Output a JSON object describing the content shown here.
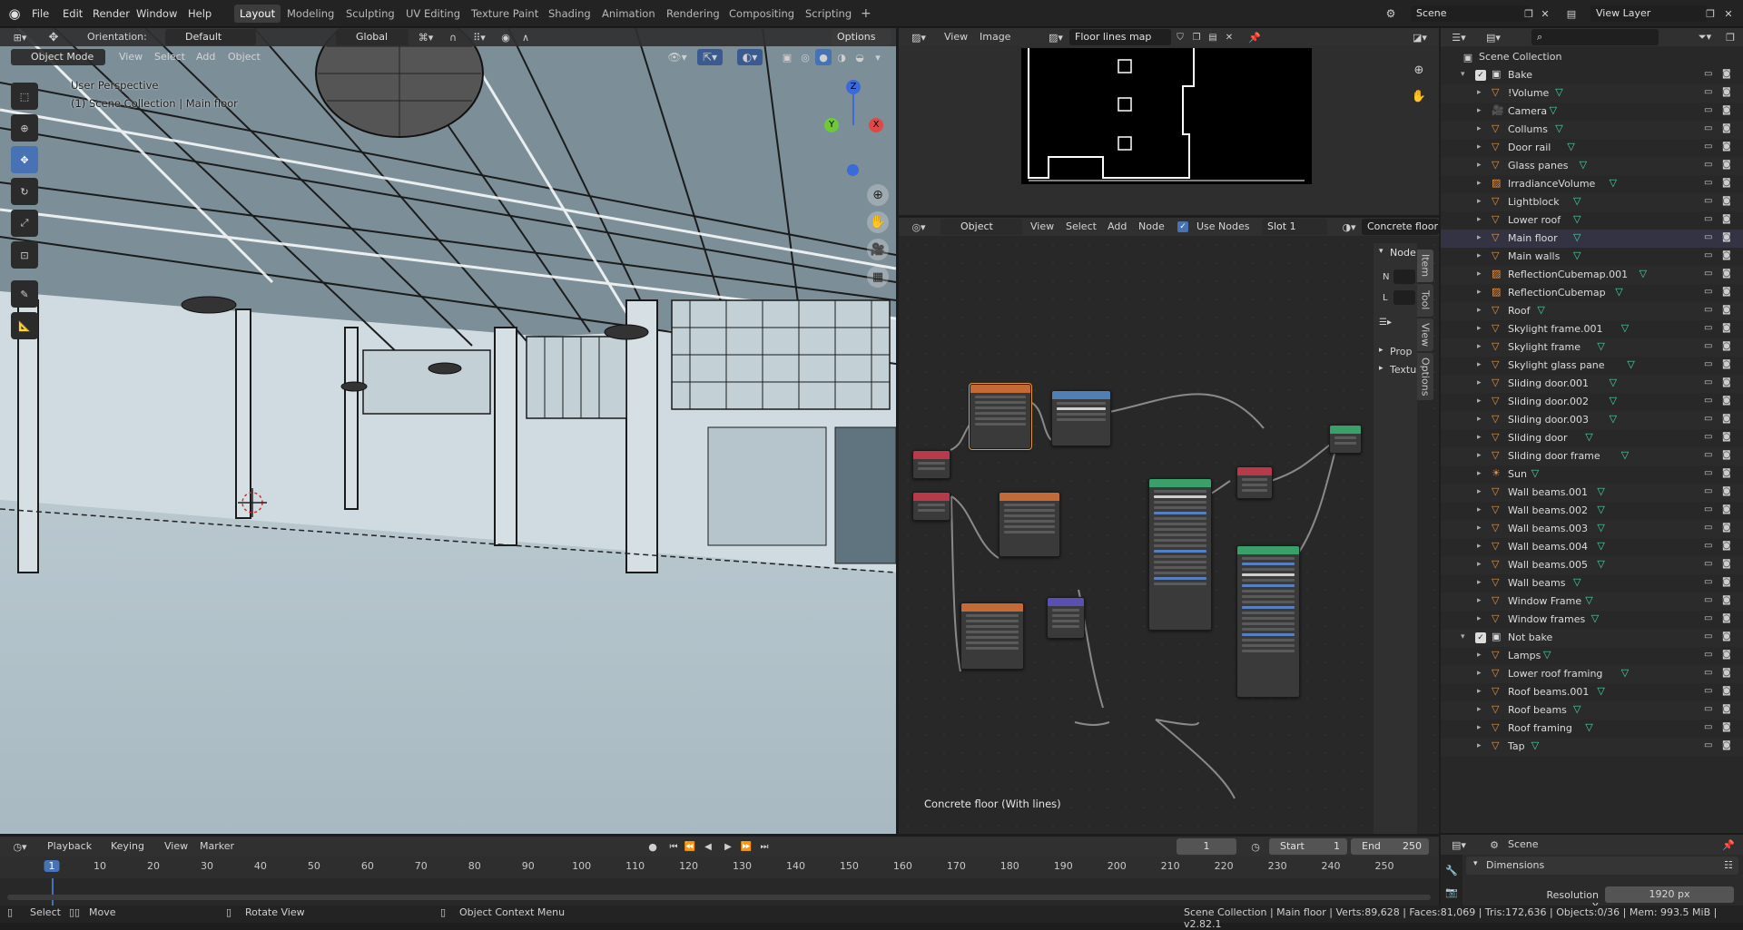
{
  "topbar": {
    "menus": [
      "File",
      "Edit",
      "Render",
      "Window",
      "Help"
    ],
    "workspaces": [
      "Layout",
      "Modeling",
      "Sculpting",
      "UV Editing",
      "Texture Paint",
      "Shading",
      "Animation",
      "Rendering",
      "Compositing",
      "Scripting"
    ],
    "add_workspace": "+",
    "scene": "Scene",
    "view_layer": "View Layer"
  },
  "viewport": {
    "orientation_label": "Orientation:",
    "orientation_value": "Default",
    "transform_space": "Global",
    "options": "Options",
    "mode": "Object Mode",
    "menus": [
      "View",
      "Select",
      "Add",
      "Object"
    ],
    "overlay_title": "User Perspective",
    "overlay_collection": "(1) Scene Collection | Main floor",
    "gizmo_axes": [
      "Z",
      "Y",
      "X"
    ]
  },
  "image_editor": {
    "menus": [
      "View",
      "Image"
    ],
    "image_name": "Floor lines map"
  },
  "node_editor": {
    "object": "Object",
    "menus": [
      "View",
      "Select",
      "Add",
      "Node"
    ],
    "use_nodes": "Use Nodes",
    "slot": "Slot 1",
    "material": "Concrete floor",
    "footer_label": "Concrete floor (With lines)",
    "sidebar_header": "Node",
    "sidebar_fields": [
      "N",
      "L"
    ],
    "sidebar_panels": [
      "Prop",
      "Textu"
    ],
    "sidebar_tabs": [
      "Item",
      "Tool",
      "View",
      "Options"
    ]
  },
  "outliner": {
    "root": "Scene Collection",
    "items": [
      {
        "label": "Bake",
        "kind": "collection"
      },
      {
        "label": "!Volume",
        "kind": "object"
      },
      {
        "label": "Camera",
        "kind": "camera"
      },
      {
        "label": "Collums",
        "kind": "object"
      },
      {
        "label": "Door rail",
        "kind": "object"
      },
      {
        "label": "Glass panes",
        "kind": "object"
      },
      {
        "label": "IrradianceVolume",
        "kind": "probe"
      },
      {
        "label": "Lightblock",
        "kind": "object"
      },
      {
        "label": "Lower roof",
        "kind": "object"
      },
      {
        "label": "Main floor",
        "kind": "object"
      },
      {
        "label": "Main walls",
        "kind": "object"
      },
      {
        "label": "ReflectionCubemap.001",
        "kind": "probe"
      },
      {
        "label": "ReflectionCubemap",
        "kind": "probe"
      },
      {
        "label": "Roof",
        "kind": "object"
      },
      {
        "label": "Skylight frame.001",
        "kind": "object"
      },
      {
        "label": "Skylight frame",
        "kind": "object"
      },
      {
        "label": "Skylight glass pane",
        "kind": "object"
      },
      {
        "label": "Sliding door.001",
        "kind": "object"
      },
      {
        "label": "Sliding door.002",
        "kind": "object"
      },
      {
        "label": "Sliding door.003",
        "kind": "object"
      },
      {
        "label": "Sliding door",
        "kind": "object"
      },
      {
        "label": "Sliding door frame",
        "kind": "object"
      },
      {
        "label": "Sun",
        "kind": "light"
      },
      {
        "label": "Wall beams.001",
        "kind": "object"
      },
      {
        "label": "Wall beams.002",
        "kind": "object"
      },
      {
        "label": "Wall beams.003",
        "kind": "object"
      },
      {
        "label": "Wall beams.004",
        "kind": "object"
      },
      {
        "label": "Wall beams.005",
        "kind": "object"
      },
      {
        "label": "Wall beams",
        "kind": "object"
      },
      {
        "label": "Window Frame",
        "kind": "object"
      },
      {
        "label": "Window frames",
        "kind": "object"
      },
      {
        "label": "Not bake",
        "kind": "collection"
      },
      {
        "label": "Lamps",
        "kind": "object"
      },
      {
        "label": "Lower roof framing",
        "kind": "object"
      },
      {
        "label": "Roof beams.001",
        "kind": "object"
      },
      {
        "label": "Roof beams",
        "kind": "object"
      },
      {
        "label": "Roof framing",
        "kind": "object"
      },
      {
        "label": "Tap",
        "kind": "object"
      }
    ]
  },
  "properties": {
    "context": "Scene",
    "panel": "Dimensions",
    "resolution_label": "Resolution X",
    "resolution_value": "1920 px"
  },
  "timeline": {
    "menus": [
      "Playback",
      "Keying",
      "View",
      "Marker"
    ],
    "current_frame": "1",
    "start_label": "Start",
    "start_value": "1",
    "end_label": "End",
    "end_value": "250",
    "ticks": [
      "1",
      "10",
      "20",
      "30",
      "40",
      "50",
      "60",
      "70",
      "80",
      "90",
      "100",
      "110",
      "120",
      "130",
      "140",
      "150",
      "160",
      "170",
      "180",
      "190",
      "200",
      "210",
      "220",
      "230",
      "240",
      "250"
    ]
  },
  "statusbar": {
    "select": "Select",
    "move": "Move",
    "rotate": "Rotate View",
    "context_menu": "Object Context Menu",
    "stats": "Scene Collection | Main floor | Verts:89,628 | Faces:81,069 | Tris:172,636 | Objects:0/36 | Mem: 993.5 MiB | v2.82.1"
  },
  "colors": {
    "accent": "#4772b3",
    "object_icon": "#e8944a",
    "mesh_data": "#4fd6a5",
    "modifier": "#6fa3f0"
  }
}
